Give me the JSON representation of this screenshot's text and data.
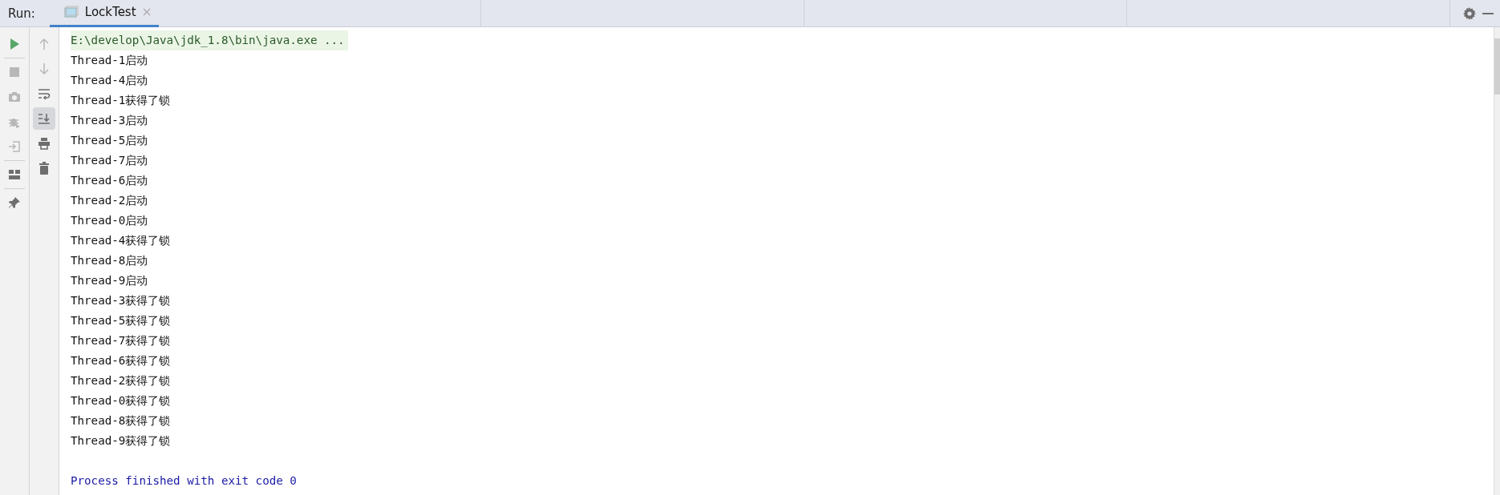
{
  "run_label": "Run:",
  "tabs": [
    {
      "label": "LockTest",
      "selected": true
    }
  ],
  "tools_left": [
    {
      "kind": "run",
      "disabled": false
    },
    {
      "kind": "stop",
      "disabled": true
    },
    {
      "kind": "camera",
      "disabled": true
    },
    {
      "kind": "debug",
      "disabled": true
    },
    {
      "kind": "login",
      "disabled": true
    },
    {
      "kind": "layout",
      "disabled": false
    },
    {
      "kind": "pin",
      "disabled": false
    }
  ],
  "tools_right": [
    {
      "kind": "up",
      "disabled": true,
      "on": false
    },
    {
      "kind": "down",
      "disabled": true,
      "on": false
    },
    {
      "kind": "wrap",
      "disabled": false,
      "on": false
    },
    {
      "kind": "scrollend",
      "disabled": false,
      "on": true
    },
    {
      "kind": "print",
      "disabled": false,
      "on": false
    },
    {
      "kind": "trash",
      "disabled": false,
      "on": false
    }
  ],
  "console_lines": [
    {
      "kind": "command",
      "text": "E:\\develop\\Java\\jdk_1.8\\bin\\java.exe ..."
    },
    {
      "kind": "output",
      "text": "Thread-1启动"
    },
    {
      "kind": "output",
      "text": "Thread-4启动"
    },
    {
      "kind": "output",
      "text": "Thread-1获得了锁"
    },
    {
      "kind": "output",
      "text": "Thread-3启动"
    },
    {
      "kind": "output",
      "text": "Thread-5启动"
    },
    {
      "kind": "output",
      "text": "Thread-7启动"
    },
    {
      "kind": "output",
      "text": "Thread-6启动"
    },
    {
      "kind": "output",
      "text": "Thread-2启动"
    },
    {
      "kind": "output",
      "text": "Thread-0启动"
    },
    {
      "kind": "output",
      "text": "Thread-4获得了锁"
    },
    {
      "kind": "output",
      "text": "Thread-8启动"
    },
    {
      "kind": "output",
      "text": "Thread-9启动"
    },
    {
      "kind": "output",
      "text": "Thread-3获得了锁"
    },
    {
      "kind": "output",
      "text": "Thread-5获得了锁"
    },
    {
      "kind": "output",
      "text": "Thread-7获得了锁"
    },
    {
      "kind": "output",
      "text": "Thread-6获得了锁"
    },
    {
      "kind": "output",
      "text": "Thread-2获得了锁"
    },
    {
      "kind": "output",
      "text": "Thread-0获得了锁"
    },
    {
      "kind": "output",
      "text": "Thread-8获得了锁"
    },
    {
      "kind": "output",
      "text": "Thread-9获得了锁"
    },
    {
      "kind": "blank"
    },
    {
      "kind": "exit",
      "text": "Process finished with exit code 0"
    }
  ]
}
